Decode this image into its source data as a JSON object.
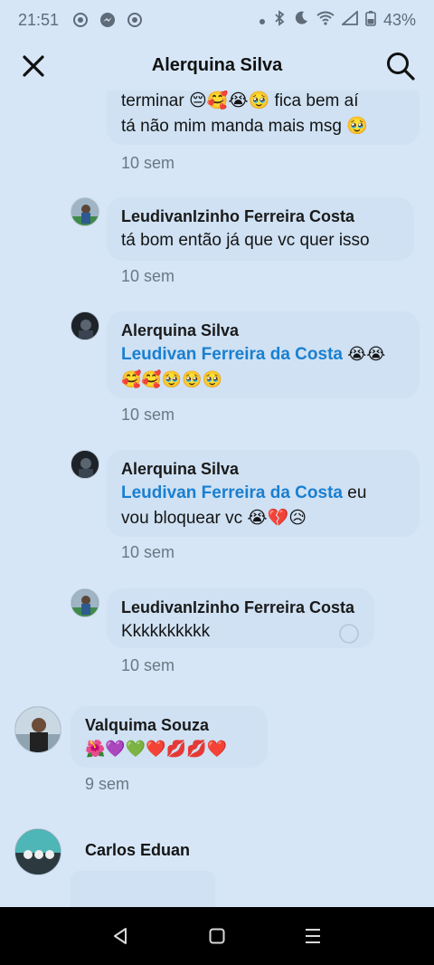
{
  "status_bar": {
    "time": "21:51",
    "battery": "43%"
  },
  "header": {
    "title": "Alerquina Silva"
  },
  "comments": [
    {
      "text": "terminar 😔🥰😭🥹 fica bem aí",
      "text2": "tá não mim manda mais msg 🥹",
      "time": "10 sem"
    },
    {
      "author": "LeudivanIzinho Ferreira Costa",
      "text": "tá bom então já que vc quer isso",
      "time": "10 sem"
    },
    {
      "author": "Alerquina Silva",
      "mention": "Leudivan Ferreira da Costa",
      "emoji_after_mention": "😭😭",
      "text2": "🥰🥰🥹🥹🥹",
      "time": "10 sem"
    },
    {
      "author": "Alerquina Silva",
      "mention": "Leudivan Ferreira da Costa",
      "text_after_mention": "eu",
      "text2": "vou bloquear vc 😭💔😥",
      "time": "10 sem"
    },
    {
      "author": "LeudivanIzinho Ferreira Costa",
      "text": "Kkkkkkkkkk",
      "time": "10 sem"
    },
    {
      "author": "Valquima Souza",
      "text": "🌺💜💚❤️💋💋❤️",
      "time": "9 sem"
    },
    {
      "author": "Carlos Eduan"
    }
  ],
  "icons": {
    "close": "close-icon",
    "search": "search-icon",
    "back": "back-icon",
    "home": "home-icon",
    "recents": "recents-icon"
  }
}
